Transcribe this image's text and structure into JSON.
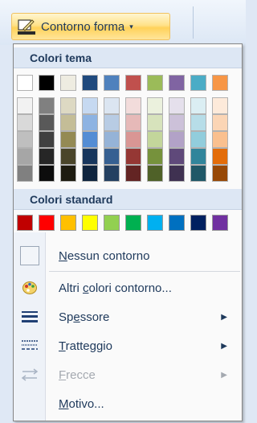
{
  "trigger": {
    "label": "Contorno forma",
    "icon": "shape-outline-icon",
    "chevron": "▾"
  },
  "sections": {
    "theme_title": "Colori tema",
    "standard_title": "Colori standard"
  },
  "theme_colors": [
    [
      "#ffffff",
      "#f2f2f2",
      "#d9d9d9",
      "#bfbfbf",
      "#a6a6a6",
      "#808080"
    ],
    [
      "#000000",
      "#808080",
      "#595959",
      "#404040",
      "#262626",
      "#0d0d0d"
    ],
    [
      "#eeece1",
      "#ddd9c3",
      "#c4bd97",
      "#948a54",
      "#4a452a",
      "#1d1b10"
    ],
    [
      "#1f497d",
      "#c6d9f1",
      "#8db3e2",
      "#548dd4",
      "#17365d",
      "#0f243e"
    ],
    [
      "#4f81bd",
      "#dbe5f1",
      "#b8cce4",
      "#95b3d7",
      "#366092",
      "#244061"
    ],
    [
      "#c0504d",
      "#f2dcdb",
      "#e6b9b8",
      "#d99694",
      "#953734",
      "#632423"
    ],
    [
      "#9bbb59",
      "#ebf1dd",
      "#d7e3bc",
      "#c3d69b",
      "#76923c",
      "#4f6128"
    ],
    [
      "#8064a2",
      "#e5e0ec",
      "#ccc1d9",
      "#b2a2c7",
      "#5f497a",
      "#3f3151"
    ],
    [
      "#4bacc6",
      "#dbeef3",
      "#b7dde8",
      "#92cddc",
      "#31859b",
      "#205867"
    ],
    [
      "#f79646",
      "#fdeada",
      "#fbd5b5",
      "#fac08f",
      "#e36c09",
      "#974806"
    ]
  ],
  "standard_colors": [
    "#c00000",
    "#ff0000",
    "#ffc000",
    "#ffff00",
    "#92d050",
    "#00b050",
    "#00b0f0",
    "#0070c0",
    "#002060",
    "#7030a0"
  ],
  "items": {
    "none": {
      "pre": "",
      "accel": "N",
      "post": "essun contorno"
    },
    "more": {
      "pre": "Altri ",
      "accel": "c",
      "post": "olori contorno..."
    },
    "weight": {
      "pre": "Sp",
      "accel": "e",
      "post": "ssore"
    },
    "dash": {
      "pre": "",
      "accel": "T",
      "post": "ratteggio"
    },
    "arrows": {
      "pre": "",
      "accel": "F",
      "post": "recce"
    },
    "pattern": {
      "pre": "",
      "accel": "M",
      "post": "otivo..."
    }
  },
  "icons": {
    "more": "palette-icon",
    "weight": "line-weight-icon",
    "dash": "dash-style-icon",
    "arrows": "arrows-icon"
  },
  "submenu_arrow": "▶"
}
